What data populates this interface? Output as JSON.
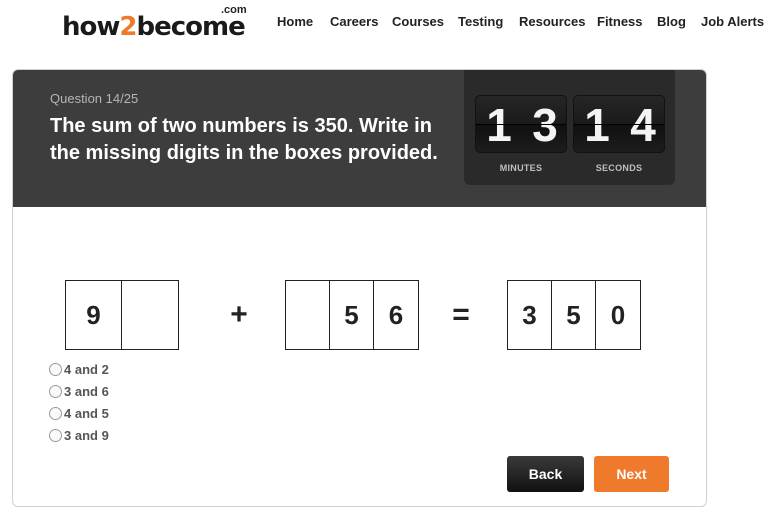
{
  "header": {
    "logo": {
      "pre": "how",
      "two": "2",
      "post": "become",
      "domain": ".com"
    },
    "nav": [
      "Home",
      "Careers",
      "Courses",
      "Testing",
      "Resources",
      "Fitness",
      "Blog",
      "Job Alerts"
    ]
  },
  "quiz": {
    "question_number": "Question 14/25",
    "question_text": "The sum of two numbers is 350. Write in the missing digits in the boxes provided.",
    "timer": {
      "minutes": [
        "1",
        "3"
      ],
      "seconds": [
        "1",
        "4"
      ],
      "minutes_label": "MINUTES",
      "seconds_label": "SECONDS"
    },
    "equation": {
      "first": [
        "9",
        ""
      ],
      "operator": "+",
      "second": [
        "",
        "5",
        "6"
      ],
      "equals": "=",
      "result": [
        "3",
        "5",
        "0"
      ]
    },
    "options": [
      "4 and 2",
      "3 and 6",
      "4 and 5",
      "3 and 9"
    ],
    "buttons": {
      "back": "Back",
      "next": "Next"
    }
  },
  "colors": {
    "accent": "#f07a2c",
    "header_bg": "#3d3d3d",
    "timer_bg": "#2a2a2a"
  }
}
